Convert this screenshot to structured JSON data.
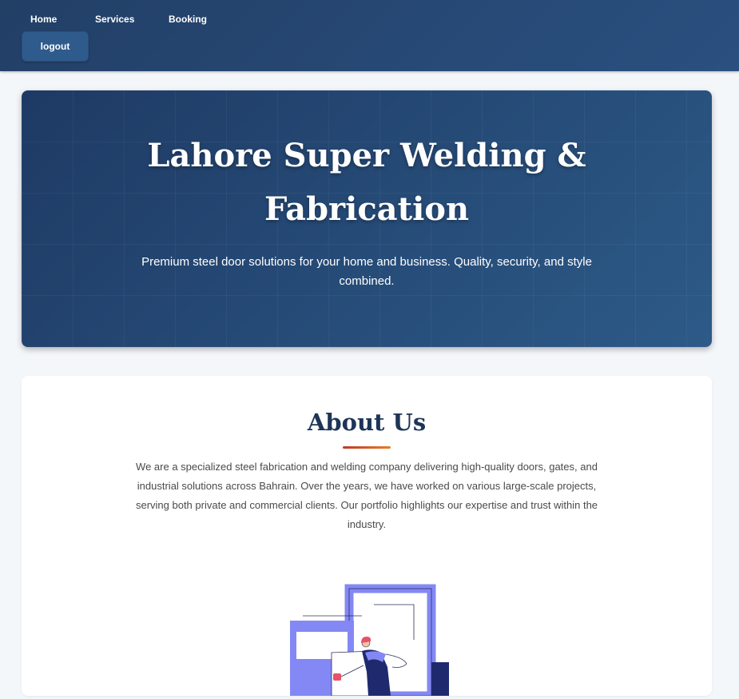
{
  "nav": {
    "links": [
      {
        "label": "Home"
      },
      {
        "label": "Services"
      },
      {
        "label": "Booking"
      }
    ],
    "logout_label": "logout"
  },
  "hero": {
    "title_line1": "Lahore Super Welding &",
    "title_line2": "Fabrication",
    "subtitle": "Premium steel door solutions for your home and business. Quality, security, and style combined."
  },
  "about": {
    "title": "About Us",
    "text": "We are a specialized steel fabrication and welding company delivering high-quality doors, gates, and industrial solutions across Bahrain. Over the years, we have worked on various large-scale projects, serving both private and commercial clients. Our portfolio highlights our expertise and trust within the industry.",
    "illustration_icon": "welder-carrying-door-illustration"
  },
  "colors": {
    "nav_bg": "#223f66",
    "hero_bg": "#1e3a64",
    "heading": "#1d3557",
    "accent_rule": "#c0392b",
    "illustration_purple": "#8388f5",
    "illustration_navy": "#1f2a6e",
    "illustration_red": "#e8516a"
  }
}
